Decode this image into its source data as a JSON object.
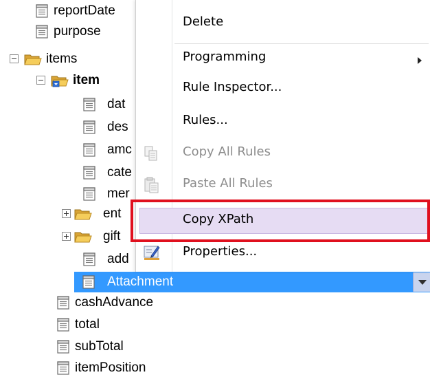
{
  "tree": {
    "nodes": [
      {
        "label": "reportDate",
        "kind": "field",
        "expander": "none",
        "bold": false
      },
      {
        "label": "purpose",
        "kind": "field",
        "expander": "none",
        "bold": false
      },
      {
        "label": "items",
        "kind": "folder",
        "expander": "minus",
        "bold": false
      },
      {
        "label": "item",
        "kind": "folder-repeating",
        "expander": "minus",
        "bold": true
      },
      {
        "label": "dat",
        "kind": "field",
        "expander": "none",
        "bold": false
      },
      {
        "label": "des",
        "kind": "field",
        "expander": "none",
        "bold": false
      },
      {
        "label": "amc",
        "kind": "field",
        "expander": "none",
        "bold": false
      },
      {
        "label": "cate",
        "kind": "field",
        "expander": "none",
        "bold": false
      },
      {
        "label": "mer",
        "kind": "field",
        "expander": "none",
        "bold": false
      },
      {
        "label": "ent",
        "kind": "folder",
        "expander": "plus",
        "bold": false
      },
      {
        "label": "gift",
        "kind": "folder",
        "expander": "plus",
        "bold": false
      },
      {
        "label": "add",
        "kind": "field",
        "expander": "none",
        "bold": false
      },
      {
        "label": "cashAdvance",
        "kind": "field",
        "expander": "none",
        "bold": false
      },
      {
        "label": "total",
        "kind": "field",
        "expander": "none",
        "bold": false
      },
      {
        "label": "subTotal",
        "kind": "field",
        "expander": "none",
        "bold": false
      },
      {
        "label": "itemPosition",
        "kind": "field",
        "expander": "none",
        "bold": false
      }
    ],
    "selected": {
      "label": "Attachment",
      "kind": "field"
    }
  },
  "context_menu": {
    "items": [
      {
        "label": "Delete",
        "enabled": true,
        "icon": "none",
        "submenu": false
      },
      {
        "label": "Programming",
        "enabled": true,
        "icon": "none",
        "submenu": true
      },
      {
        "label": "Rule Inspector...",
        "enabled": true,
        "icon": "none",
        "submenu": false
      },
      {
        "label": "Rules...",
        "enabled": true,
        "icon": "none",
        "submenu": false
      },
      {
        "label": "Copy All Rules",
        "enabled": false,
        "icon": "copy-rules-icon",
        "submenu": false
      },
      {
        "label": "Paste All Rules",
        "enabled": false,
        "icon": "paste-rules-icon",
        "submenu": false
      },
      {
        "label": "Copy XPath",
        "enabled": true,
        "icon": "none",
        "submenu": false,
        "highlighted": true
      },
      {
        "label": "Properties...",
        "enabled": true,
        "icon": "properties-icon",
        "submenu": false
      }
    ]
  },
  "colors": {
    "selection": "#3399ff",
    "menu_hover": "#e6dcf3",
    "annotation_box": "#e0101e",
    "disabled_text": "#8d8d8d"
  }
}
